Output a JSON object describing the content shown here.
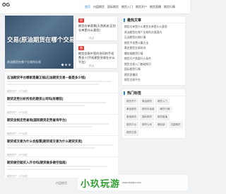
{
  "site": {
    "logo": "OG"
  },
  "nav": [
    "首页",
    "内盘期货",
    "国际期货",
    "期货入门",
    "期货开户",
    "期货直播",
    "期货行情"
  ],
  "hero": {
    "title": "交易(原油期货在哪个交易",
    "caption": "原油期货在哪个交易所交易"
  },
  "side_cards": [
    {
      "tag": "原",
      "title": "期货仓单背景(天然原油 区别仓单是什么意思)",
      "ad": "热点"
    },
    {
      "tag": "期",
      "title": "期货交易中签约合同的手续费多少(手机期货交易在什么平台)",
      "ad": "热点"
    }
  ],
  "posts": [
    {
      "title": "石油期货平台哪家是最正规(石油期货交易一般是多少钱)",
      "meta": "期货开户 · 4个月前"
    },
    {
      "title": "期货走势分析所有的期货公司吗(有哪些)",
      "meta": "期货开户 · 4个月前"
    },
    {
      "title": "期货含税走势查询(国际期货走势查询平台)",
      "meta": "期货开户 · 4个月前"
    },
    {
      "title": "期货或交易为什么会股票(期货或交易为什么期货买卖)",
      "meta": "期货开户 · 4个月前"
    },
    {
      "title": "期货做空就买入开仓吗(期货做多做空指南)",
      "meta": "期货开户 · 4个月前"
    }
  ],
  "more_label": "内盘期货",
  "sidebar": {
    "recommend_title": "最热文章",
    "recommend": [
      "期货仓单是什么期货仓单是什么意思",
      "原油期货在哪个交易所交易国内",
      "石油期货价格行情",
      "期货手续费计算方法",
      "黄金期货交易时间",
      "螺纹钢期货行情",
      "期货开户需要什么条件",
      "期货交易入门基础知识",
      "国际期货行情",
      "期货直播间",
      "期货交易平台"
    ],
    "tags_title": "热门标签",
    "tags": [
      "期货开户",
      "原油期货",
      "期货入门",
      "黄金期货",
      "期货手续费",
      "期货行情",
      "股指期货",
      "国际期货",
      "期货直播",
      "期货平台",
      "期货公司",
      "螺纹钢",
      "白银期货",
      "期货交易"
    ]
  },
  "overlay": {
    "text": "小玖玩游",
    "sub": "www.xiaojiu.com"
  }
}
